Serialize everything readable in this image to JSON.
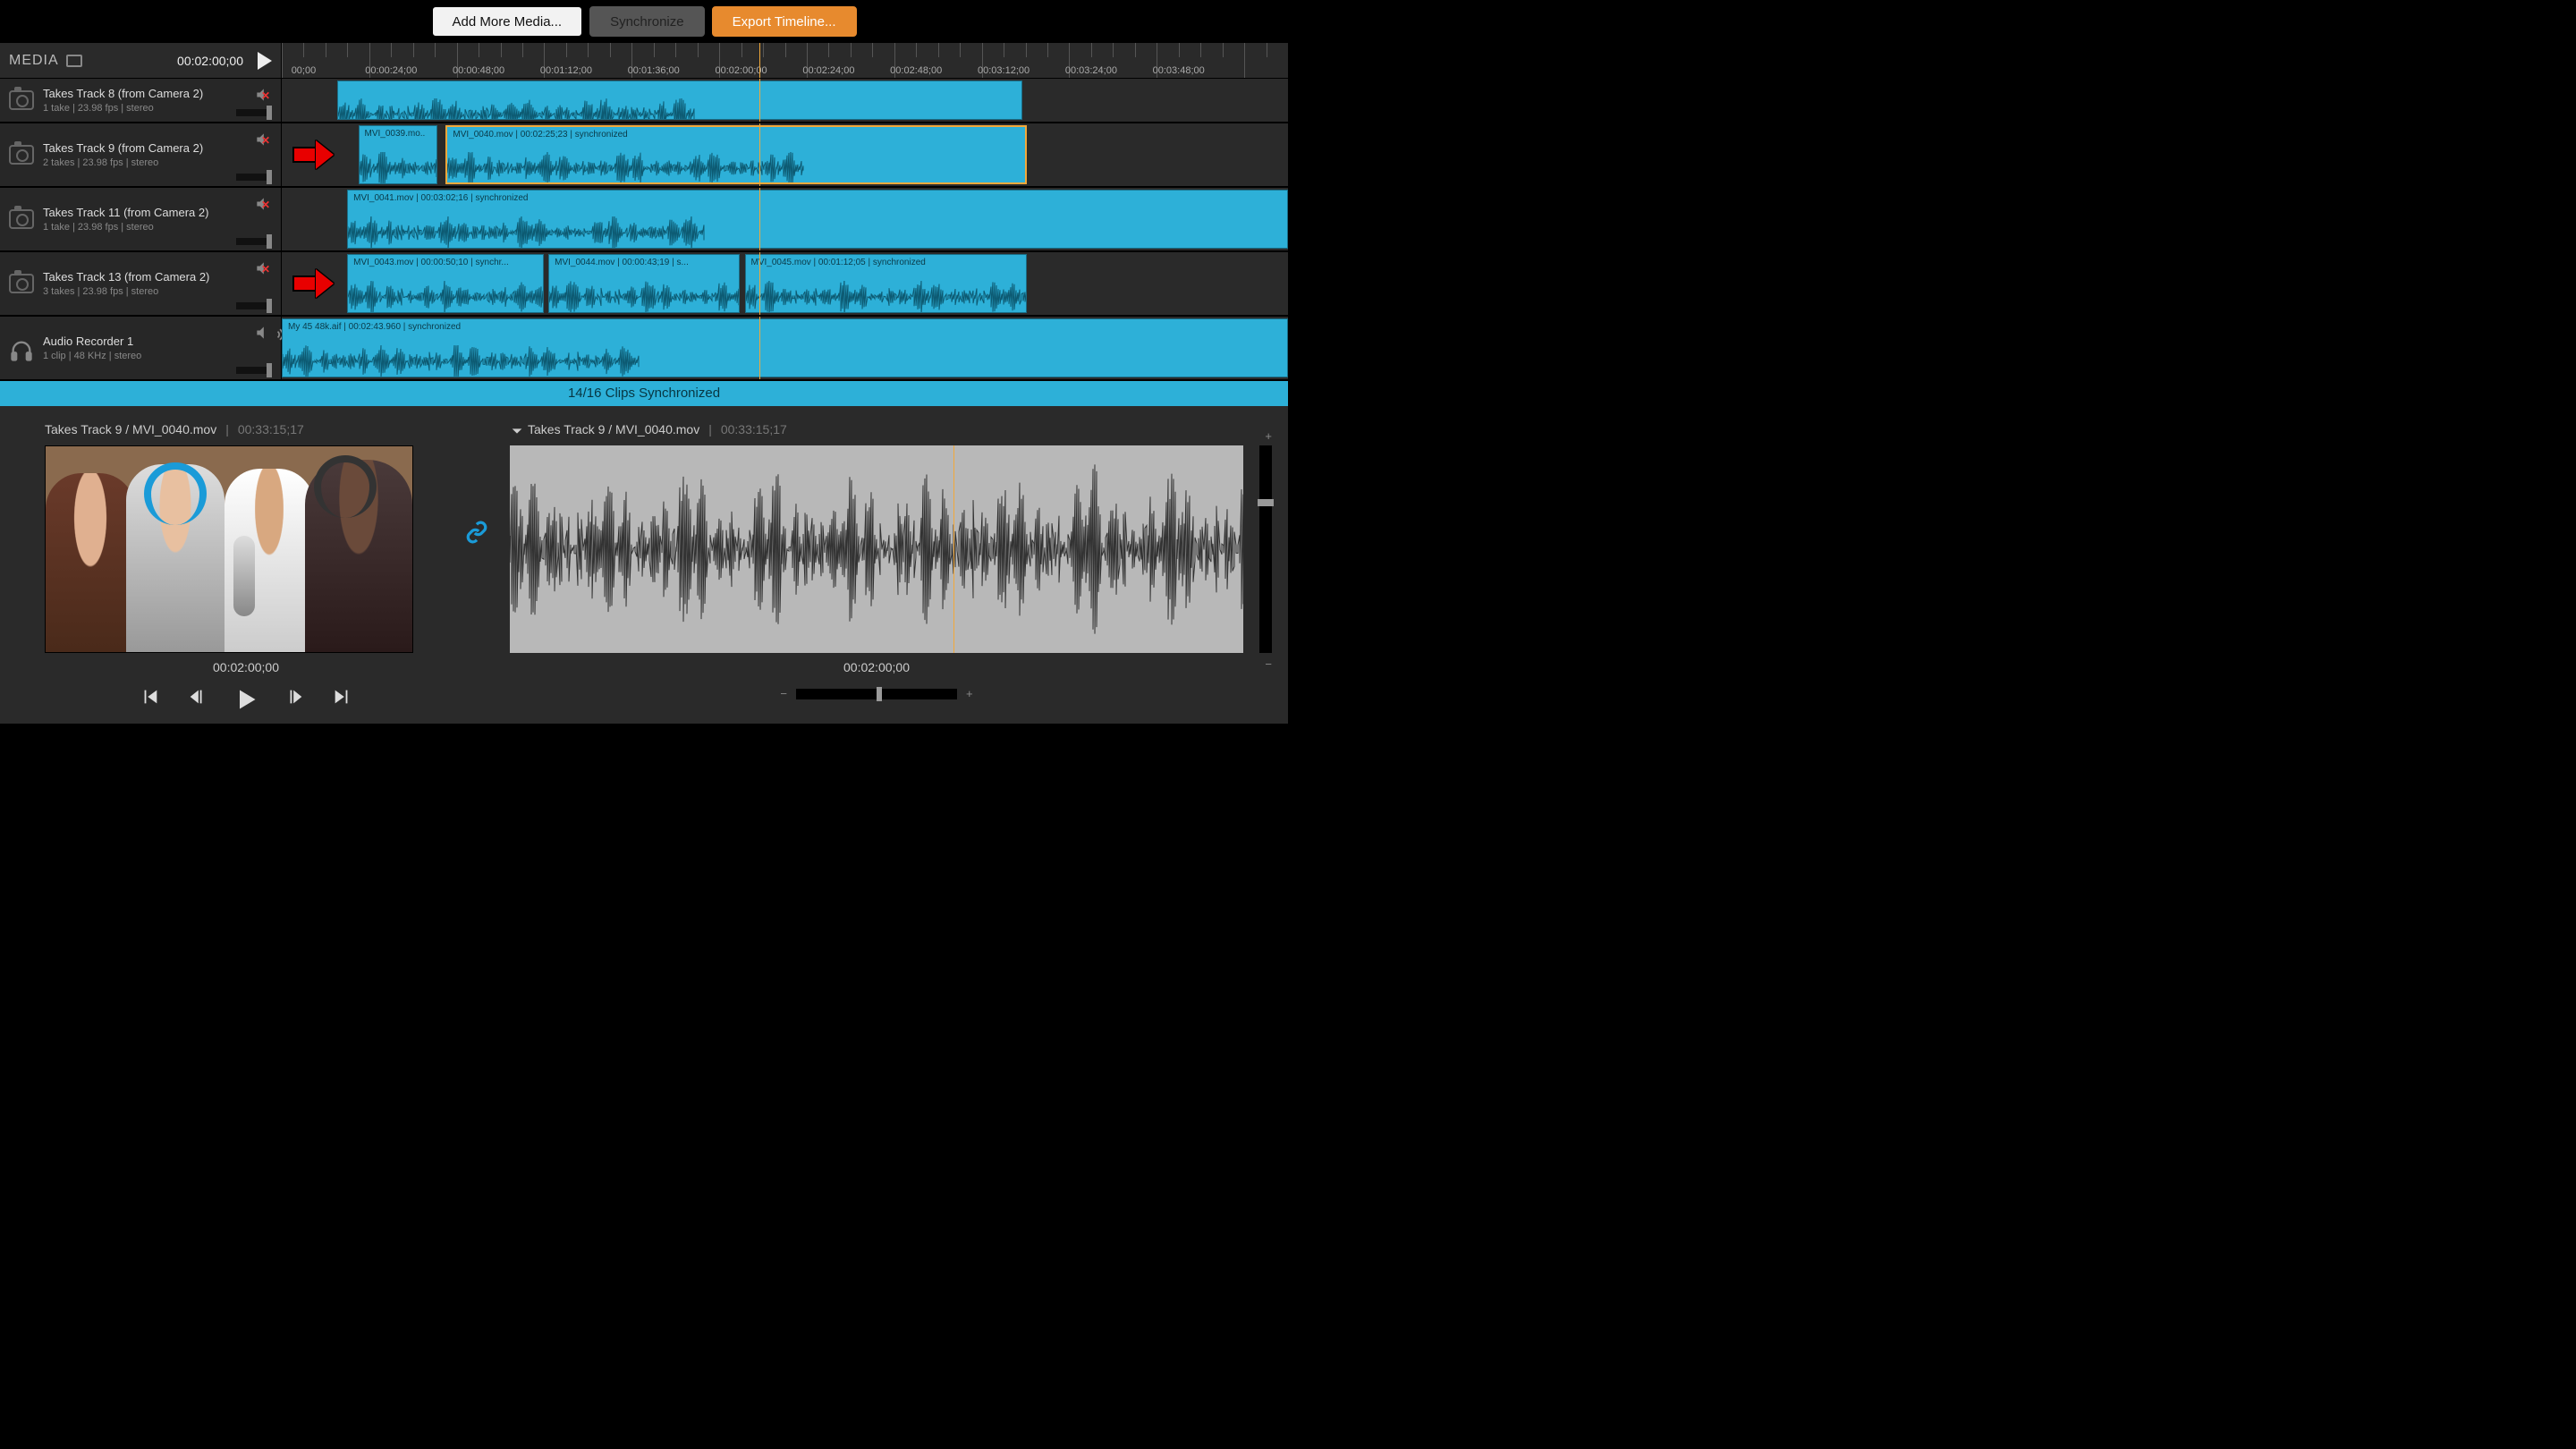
{
  "toolbar": {
    "add": "Add More Media...",
    "sync": "Synchronize",
    "export": "Export Timeline..."
  },
  "media": {
    "label": "MEDIA",
    "timecode": "00:02:00;00"
  },
  "ruler": {
    "labels": [
      "00;00",
      "00:00:24;00",
      "00:00:48;00",
      "00:01:12;00",
      "00:01:36;00",
      "00:02:00;00",
      "00:02:24;00",
      "00:02:48;00",
      "00:03:12;00",
      "00:03:24;00",
      "00:03:48;00"
    ],
    "playhead_frac": 0.475
  },
  "tracks": [
    {
      "name": "Takes Track 8 (from Camera 2)",
      "meta": "1 take   |   23.98 fps   |   stereo",
      "icon": "camera",
      "muted": true,
      "partial": true,
      "arrow": false,
      "clips": [
        {
          "start": 0.055,
          "end": 0.736,
          "label": ""
        }
      ]
    },
    {
      "name": "Takes Track 9 (from Camera 2)",
      "meta": "2 takes   |   23.98 fps   |   stereo",
      "icon": "camera",
      "muted": true,
      "arrow": true,
      "clips": [
        {
          "start": 0.076,
          "end": 0.155,
          "label": "MVI_0039.mo.."
        },
        {
          "start": 0.163,
          "end": 0.74,
          "label": "MVI_0040.mov  |  00:02:25;23  |  synchronized",
          "selected": true
        }
      ]
    },
    {
      "name": "Takes Track 11 (from Camera 2)",
      "meta": "1 take   |   23.98 fps   |   stereo",
      "icon": "camera",
      "muted": true,
      "arrow": false,
      "clips": [
        {
          "start": 0.065,
          "end": 1.0,
          "label": "MVI_0041.mov  |  00:03:02;16  |  synchronized"
        }
      ]
    },
    {
      "name": "Takes Track 13 (from Camera 2)",
      "meta": "3 takes   |   23.98 fps   |   stereo",
      "icon": "camera",
      "muted": true,
      "arrow": true,
      "clips": [
        {
          "start": 0.065,
          "end": 0.26,
          "label": "MVI_0043.mov  |  00:00:50;10  |  synchr..."
        },
        {
          "start": 0.265,
          "end": 0.455,
          "label": "MVI_0044.mov  |  00:00:43;19  |  s..."
        },
        {
          "start": 0.46,
          "end": 0.74,
          "label": "MVI_0045.mov  |  00:01:12;05  |  synchronized"
        }
      ]
    },
    {
      "name": "Audio Recorder 1",
      "meta": "1 clip   |   48 KHz   |   stereo",
      "icon": "headphones",
      "muted": false,
      "arrow": false,
      "clips": [
        {
          "start": 0.0,
          "end": 1.0,
          "label": "My 45 48k.aif  |  00:02:43.960  |  synchronized"
        }
      ]
    }
  ],
  "sync_status": "14/16 Clips Synchronized",
  "preview": {
    "left_title": "Takes Track 9 / MVI_0040.mov",
    "left_tc": "00:33:15;17",
    "right_title": "Takes Track 9 / MVI_0040.mov",
    "right_tc": "00:33:15;17",
    "below_tc_left": "00:02:00;00",
    "below_tc_right": "00:02:00;00",
    "wave_play_frac": 0.605,
    "zoom": {
      "minus": "−",
      "plus": "+"
    }
  }
}
